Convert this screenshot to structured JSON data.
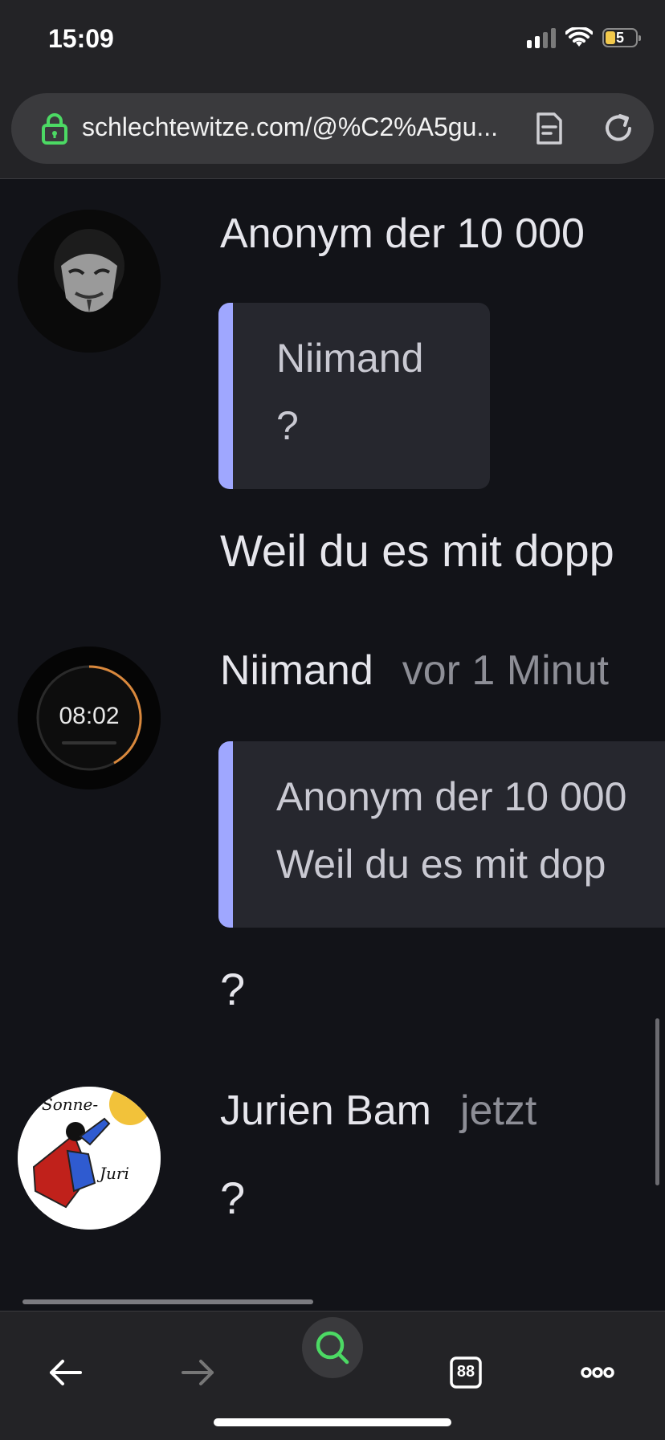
{
  "status_bar": {
    "time": "15:09",
    "battery": "5"
  },
  "url_bar": {
    "url": "schlechtewitze.com/@%C2%A5gu...",
    "lock_icon": "lock-icon",
    "reader_icon": "reader-mode-icon",
    "reload_icon": "reload-icon"
  },
  "comments": [
    {
      "author": "Anonym der 10 000",
      "time": "",
      "quote_author": "Niimand",
      "quote_text": "?",
      "text": "Weil du es mit dopp"
    },
    {
      "author": "Niimand",
      "time": "vor 1 Minut",
      "quote_author": "Anonym der 10 000",
      "quote_text": "Weil du es mit dop",
      "text": "?"
    },
    {
      "author": "Jurien Bam",
      "time": "jetzt",
      "text": "?"
    }
  ],
  "avatar_text": {
    "clock": "08:02",
    "sonne": "Sonne-",
    "juri": "Juri"
  },
  "toolbar": {
    "tabs_count": "88",
    "icons": [
      "back-arrow-icon",
      "forward-arrow-icon",
      "search-icon",
      "tabs-icon",
      "more-icon"
    ]
  },
  "colors": {
    "accent": "#4cd964",
    "quote_bar": "#9fa7ff",
    "background": "#121318"
  }
}
